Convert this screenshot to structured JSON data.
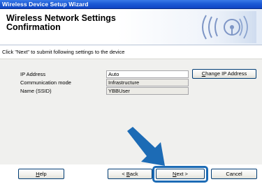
{
  "window": {
    "title": "Wireless Device Setup Wizard"
  },
  "header": {
    "title": "Wireless Network Settings\nConfirmation",
    "logo_icon": "wireless-signal-icon"
  },
  "instruction": "Click \"Next\" to submit following settings to the device",
  "settings": [
    {
      "label": "IP Address",
      "value": "Auto"
    },
    {
      "label": "Communication mode",
      "value": "Infrastructure"
    },
    {
      "label": "Name (SSID)",
      "value": "YBBUser"
    }
  ],
  "change_ip_button": {
    "pre": "",
    "key": "C",
    "post": "hange IP Address"
  },
  "footer": {
    "help": {
      "pre": "",
      "key": "H",
      "post": "elp"
    },
    "back": {
      "pre": "< ",
      "key": "B",
      "post": "ack"
    },
    "next": {
      "pre": "",
      "key": "N",
      "post": "ext >"
    },
    "cancel": {
      "pre": "",
      "key": "",
      "post": "Cancel"
    }
  },
  "colors": {
    "titlebar": "#1c5bd6",
    "arrow": "#1c6bb5",
    "panel": "#f0f0ee"
  }
}
